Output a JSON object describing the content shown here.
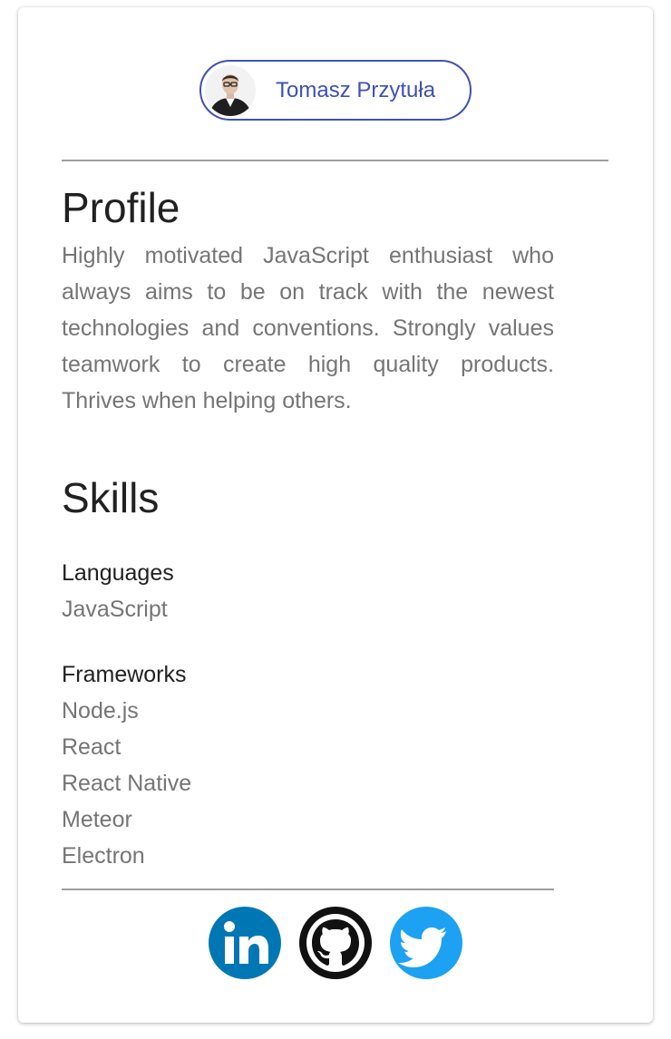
{
  "profile_chip": {
    "name": "Tomasz Przytuła"
  },
  "profile": {
    "heading": "Profile",
    "summary": "Highly motivated JavaScript enthusiast who always aims to be on track with the newest technologies and conventions. Strongly values teamwork to create high quality products. Thrives when helping others."
  },
  "skills": {
    "heading": "Skills",
    "languages": {
      "label": "Languages",
      "items": [
        "JavaScript"
      ]
    },
    "frameworks": {
      "label": "Frameworks",
      "items": [
        "Node.js",
        "React",
        "React Native",
        "Meteor",
        "Electron"
      ]
    }
  },
  "social": [
    {
      "icon": "linkedin-icon",
      "color": "#0077b5"
    },
    {
      "icon": "github-icon",
      "color": "#111111"
    },
    {
      "icon": "twitter-icon",
      "color": "#1da1f2"
    }
  ],
  "colors": {
    "accent": "#3f51b5",
    "text_primary": "#212121",
    "text_secondary": "#757575"
  }
}
